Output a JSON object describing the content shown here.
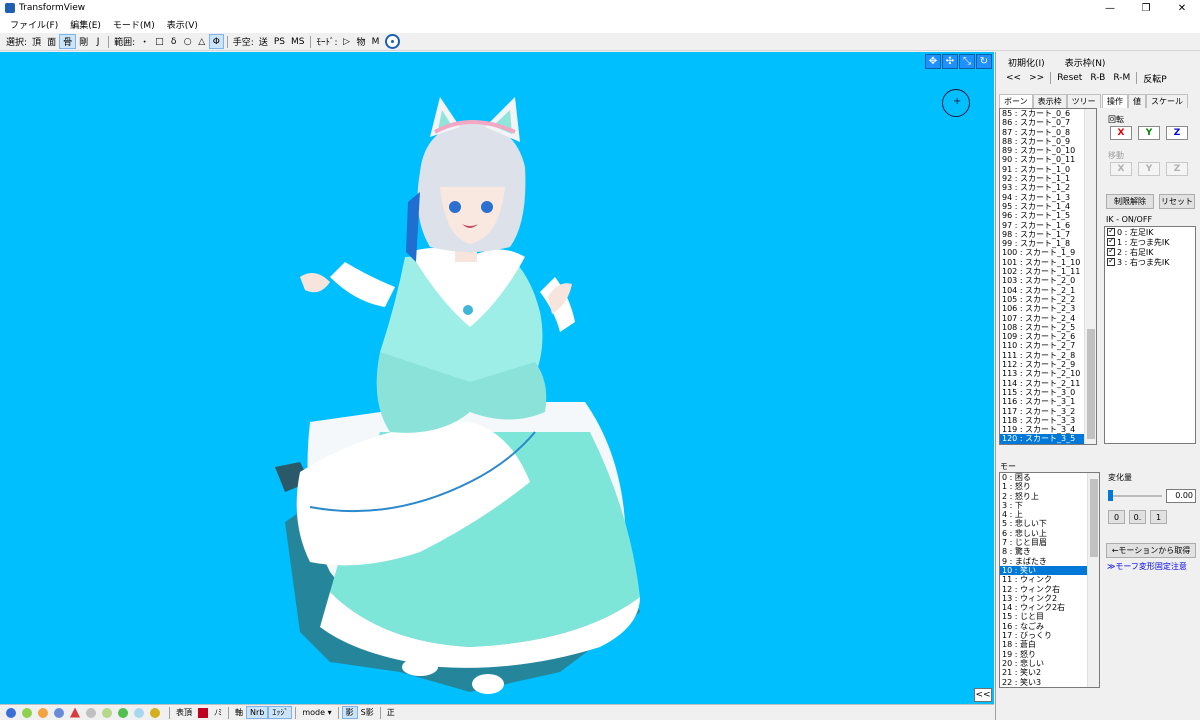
{
  "window": {
    "title": "TransformView",
    "minimize": "—",
    "maximize": "❐",
    "close": "✕"
  },
  "menu": [
    "ファイル(F)",
    "編集(E)",
    "モード(M)",
    "表示(V)"
  ],
  "toolbar": {
    "select_label": "選択:",
    "select_items": [
      "頂",
      "面",
      "骨",
      "剛",
      "J"
    ],
    "select_active": "骨",
    "range_label": "範囲:",
    "range_items": [
      "・",
      "□",
      "δ",
      "○",
      "△",
      "Φ"
    ],
    "range_active": "Φ",
    "pivot_label": "手空:",
    "pivot_items": [
      "送",
      "PS",
      "MS"
    ],
    "mode_label": "ﾓｰﾄﾞ:",
    "mode_items": [
      "▷",
      "物",
      "M"
    ]
  },
  "viewport": {
    "background": "#00bfff",
    "tool_icons": [
      "move-icon",
      "move-all-icon",
      "scale-icon",
      "rotate-icon"
    ],
    "collapse": "<<"
  },
  "right_panel": {
    "init": "初期化(I)",
    "display_frame": "表示枠(N)",
    "prev": "<<",
    "next": ">>",
    "reset": "Reset",
    "rb": "R-B",
    "rm": "R-M",
    "flip": "反転P",
    "bone_tabs": [
      "ボーン",
      "表示枠",
      "ツリー"
    ],
    "bones": [
      "85 : スカート_0_6",
      "86 : スカート_0_7",
      "87 : スカート_0_8",
      "88 : スカート_0_9",
      "89 : スカート_0_10",
      "90 : スカート_0_11",
      "91 : スカート_1_0",
      "92 : スカート_1_1",
      "93 : スカート_1_2",
      "94 : スカート_1_3",
      "95 : スカート_1_4",
      "96 : スカート_1_5",
      "97 : スカート_1_6",
      "98 : スカート_1_7",
      "99 : スカート_1_8",
      "100 : スカート_1_9",
      "101 : スカート_1_10",
      "102 : スカート_1_11",
      "103 : スカート_2_0",
      "104 : スカート_2_1",
      "105 : スカート_2_2",
      "106 : スカート_2_3",
      "107 : スカート_2_4",
      "108 : スカート_2_5",
      "109 : スカート_2_6",
      "110 : スカート_2_7",
      "111 : スカート_2_8",
      "112 : スカート_2_9",
      "113 : スカート_2_10",
      "114 : スカート_2_11",
      "115 : スカート_3_0",
      "116 : スカート_3_1",
      "117 : スカート_3_2",
      "118 : スカート_3_3",
      "119 : スカート_3_4",
      "120 : スカート_3_5"
    ],
    "bone_selected_index": 35,
    "op_tabs": [
      "操作",
      "値",
      "スケール"
    ],
    "rotate_label": "回転",
    "move_label": "移動",
    "axes": [
      "X",
      "Y",
      "Z"
    ],
    "limit_release": "制限解除",
    "reset_btn": "リセット",
    "ik_label": "IK - ON/OFF",
    "ik_items": [
      "0 : 左足IK",
      "1 : 左つま先IK",
      "2 : 右足IK",
      "3 : 右つま先IK"
    ],
    "morph_label": "モー",
    "morphs": [
      "0 : 困る",
      "1 : 怒り",
      "2 : 怒り上",
      "3 : 下",
      "4 : 上",
      "5 : 悲しい下",
      "6 : 悲しい上",
      "7 : じと目眉",
      "8 : 驚き",
      "9 : まばたき",
      "10 : 笑い",
      "11 : ウィンク",
      "12 : ウィンク右",
      "13 : ウィンク2",
      "14 : ウィンク2右",
      "15 : じと目",
      "16 : なごみ",
      "17 : びっくり",
      "18 : 蒼白",
      "19 : 怒り",
      "20 : 悲しい",
      "21 : 笑い2",
      "22 : 笑い3"
    ],
    "morph_selected_index": 10,
    "amount_label": "変化量",
    "amount_value": "0.00",
    "amount_level": 0,
    "presets": [
      "0",
      "0.",
      "1"
    ],
    "from_motion": "←モーションから取得",
    "morph_note": "≫モーフ変形固定注意"
  },
  "statusbar": {
    "items": [
      "表頂",
      "ﾉﾐ",
      "軸",
      "Nrb",
      "ｴｯｼﾞ",
      "mode ▾",
      "影",
      "S影",
      "正"
    ]
  }
}
